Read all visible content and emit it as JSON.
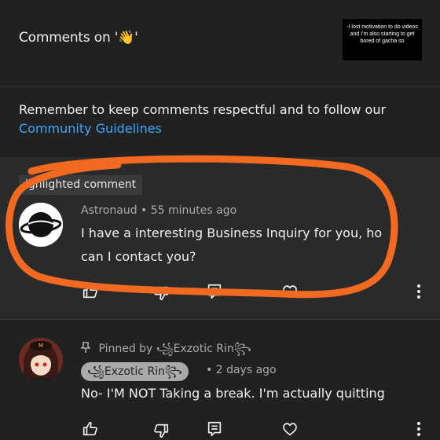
{
  "header": {
    "title": "Comments on '👋'",
    "thumbnail_caption": "-I lost motivation to do videos and I'm also starting to get bored of gacha so"
  },
  "guidelines": {
    "text": "Remember to keep comments respectful and to follow our",
    "link": "Community Guidelines"
  },
  "highlighted": {
    "chip": "ighlighted comment",
    "comment": {
      "author": "Astronaud",
      "separator": "•",
      "time": "55 minutes ago",
      "text_line1": "I have a interesting Business Inquiry for you, ho",
      "text_line2": "can I contact you?"
    }
  },
  "pinned": {
    "pinned_by_label": "Pinned by",
    "pinned_by_name": "꧁Exzotic Rin꧂",
    "author_chip": "꧁Exzotic Rin꧂",
    "separator": "•",
    "time": "2 days ago",
    "text": "No- I'M NOT Taking a break. I'm actually quitting"
  },
  "icons": [
    "thumbs-up-icon",
    "thumbs-down-icon",
    "reply-icon",
    "heart-icon",
    "more-vert-icon",
    "pin-icon",
    "planet-avatar"
  ],
  "colors": {
    "background": "#212121",
    "highlight_bg": "#2a2a2a",
    "link": "#3ea6ff",
    "annotation": "#f26a21"
  }
}
